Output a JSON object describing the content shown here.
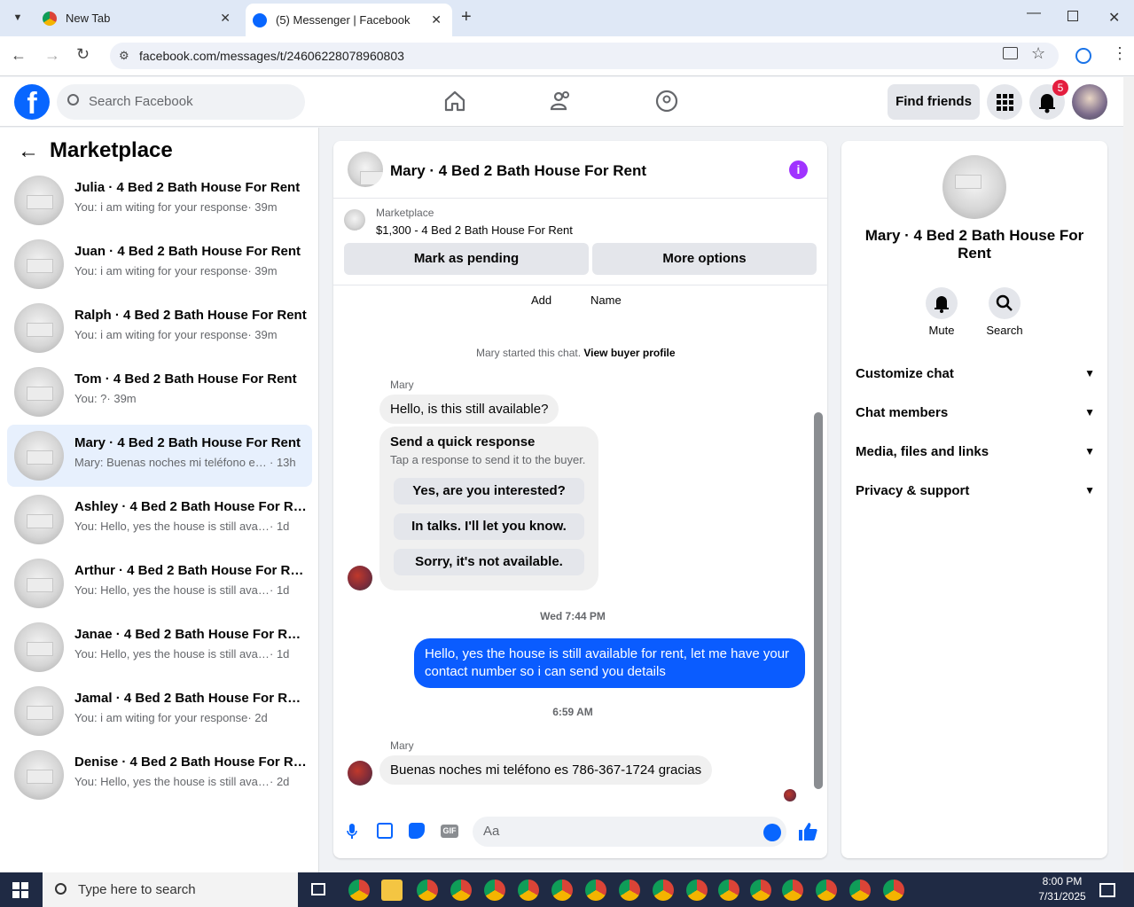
{
  "browser": {
    "tabs": [
      {
        "label": "New Tab"
      },
      {
        "label": "(5) Messenger | Facebook"
      }
    ],
    "url": "facebook.com/messages/t/24606228078960803"
  },
  "fbnav": {
    "search_placeholder": "Search Facebook",
    "find_friends": "Find friends",
    "notif_count": "5"
  },
  "left": {
    "title": "Marketplace",
    "conversations": [
      {
        "name": "Julia · 4 Bed 2 Bath House For Rent",
        "preview": "You: i am witing for your response",
        "time": "· 39m"
      },
      {
        "name": "Juan · 4 Bed 2 Bath House For Rent",
        "preview": "You: i am witing for your response",
        "time": "· 39m"
      },
      {
        "name": "Ralph · 4 Bed 2 Bath House For Rent",
        "preview": "You: i am witing for your response",
        "time": "· 39m"
      },
      {
        "name": "Tom · 4 Bed 2 Bath House For Rent",
        "preview": "You: ?",
        "time": "· 39m"
      },
      {
        "name": "Mary · 4 Bed 2 Bath House For Rent",
        "preview": "Mary: Buenas noches mi teléfono es 786-367-1724 gracias",
        "time": "· 13h"
      },
      {
        "name": "Ashley · 4 Bed 2 Bath House For Rent",
        "preview": "You: Hello, yes the house is still available for rent",
        "time": "· 1d"
      },
      {
        "name": "Arthur · 4 Bed 2 Bath House For Rent",
        "preview": "You: Hello, yes the house is still available for rent",
        "time": "· 1d"
      },
      {
        "name": "Janae · 4 Bed 2 Bath House For Rent",
        "preview": "You: Hello, yes the house is still available for rent",
        "time": "· 1d"
      },
      {
        "name": "Jamal · 4 Bed 2 Bath House For Rent",
        "preview": "You: i am witing for your response",
        "time": "· 2d"
      },
      {
        "name": "Denise · 4 Bed 2 Bath House For Rent",
        "preview": "You: Hello, yes the house is still available for rent",
        "time": "· 2d"
      }
    ]
  },
  "chat": {
    "title": "Mary · 4 Bed 2 Bath House For Rent",
    "listing_source": "Marketplace",
    "listing_desc": "$1,300 - 4 Bed 2 Bath House For Rent",
    "mark_pending": "Mark as pending",
    "more_options": "More options",
    "add_label": "Add",
    "name_label": "Name",
    "started_text": "Mary started this chat.",
    "view_profile": "View buyer profile",
    "sender": "Mary",
    "msg1": "Hello, is this still available?",
    "quick_title": "Send a quick response",
    "quick_sub": "Tap a response to send it to the buyer.",
    "quick_replies": [
      "Yes, are you interested?",
      "In talks. I'll let you know.",
      "Sorry, it's not available."
    ],
    "time1": "Wed 7:44 PM",
    "msg_out": "Hello, yes the house is still available for rent, let me have your contact number so i can send you  details",
    "time2": "6:59 AM",
    "msg2": "Buenas noches mi teléfono es 786-367-1724 gracias",
    "composer_placeholder": "Aa"
  },
  "right": {
    "title": "Mary · 4 Bed 2 Bath House For Rent",
    "mute": "Mute",
    "search": "Search",
    "sections": [
      "Customize chat",
      "Chat members",
      "Media, files and links",
      "Privacy & support"
    ]
  },
  "taskbar": {
    "search_placeholder": "Type here to search",
    "time": "8:00 PM",
    "date": "7/31/2025"
  },
  "colors": {
    "brand": "#0866ff",
    "outgoing": "#0a5cff",
    "info": "#a033ff"
  }
}
